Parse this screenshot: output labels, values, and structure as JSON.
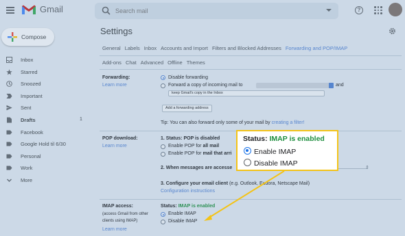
{
  "app": {
    "name": "Gmail"
  },
  "search": {
    "placeholder": "Search mail"
  },
  "icons": {
    "help": "?"
  },
  "compose": {
    "label": "Compose"
  },
  "sidebar": {
    "items": [
      {
        "label": "Inbox",
        "icon": "inbox-icon",
        "count": ""
      },
      {
        "label": "Starred",
        "icon": "star-icon",
        "count": ""
      },
      {
        "label": "Snoozed",
        "icon": "clock-icon",
        "count": ""
      },
      {
        "label": "Important",
        "icon": "important-icon",
        "count": ""
      },
      {
        "label": "Sent",
        "icon": "send-icon",
        "count": ""
      },
      {
        "label": "Drafts",
        "icon": "draft-icon",
        "count": "1"
      },
      {
        "label": "Facebook",
        "icon": "label-icon",
        "count": ""
      },
      {
        "label": "Google Hold til 6/30",
        "icon": "label-icon",
        "count": ""
      },
      {
        "label": "Personal",
        "icon": "label-icon",
        "count": ""
      },
      {
        "label": "Work",
        "icon": "label-icon",
        "count": ""
      },
      {
        "label": "More",
        "icon": "chevron-down-icon",
        "count": ""
      }
    ]
  },
  "settings": {
    "title": "Settings",
    "tabs": [
      "General",
      "Labels",
      "Inbox",
      "Accounts and Import",
      "Filters and Blocked Addresses",
      "Forwarding and POP/IMAP"
    ],
    "active_tab": "Forwarding and POP/IMAP",
    "tabs2": [
      "Add-ons",
      "Chat",
      "Advanced",
      "Offline",
      "Themes"
    ],
    "forwarding": {
      "title": "Forwarding:",
      "learn_more": "Learn more",
      "disable": "Disable forwarding",
      "forward_copy": "Forward a copy of incoming mail to",
      "and": "and",
      "keep_copy": "keep Gmail's copy in the Inbox",
      "add_address": "Add a forwarding address",
      "tip_prefix": "Tip: You can also forward only some of your mail by",
      "tip_link": "creating a filter!"
    },
    "pop": {
      "title": "POP download:",
      "learn_more": "Learn more",
      "status": "1. Status: POP is disabled",
      "enable_all_prefix": "Enable POP for",
      "enable_all_bold": "all mail",
      "enable_now_prefix": "Enable POP for",
      "enable_now_bold": "mail that arri",
      "step2": "2. When messages are accesse",
      "step3_bold": "3. Configure your email client",
      "step3_rest": " (e.g. Outlook, Eudora, Netscape Mail)",
      "config": "Configuration instructions"
    },
    "imap": {
      "title": "IMAP access:",
      "sub": "(access Gmail from other clients using IMAP)",
      "sub1": "(access Gmail from other",
      "sub2": "clients using IMAP)",
      "learn_more": "Learn more",
      "status_prefix": "Status:",
      "status_value": "IMAP is enabled",
      "enable": "Enable IMAP",
      "disable": "Disable IMAP"
    }
  },
  "callout": {
    "status_prefix": "Status:",
    "status_value": "IMAP is enabled",
    "enable": "Enable IMAP",
    "disable": "Disable IMAP"
  },
  "colors": {
    "accent": "#4f7fd0",
    "enabled_green": "#1e8e3e",
    "callout_border": "#f4c316"
  }
}
